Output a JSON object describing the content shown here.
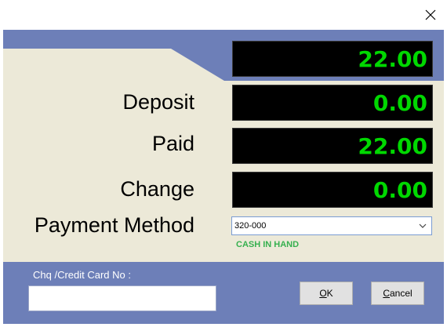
{
  "window": {
    "close_icon": "close-icon"
  },
  "displays": {
    "total": "22.00",
    "deposit": "0.00",
    "paid": "22.00",
    "change": "0.00"
  },
  "labels": {
    "deposit": "Deposit",
    "paid": "Paid",
    "change": "Change",
    "payment_method": "Payment Method"
  },
  "payment_method": {
    "selected": "320-000",
    "description": "CASH IN HAND"
  },
  "card": {
    "label": "Chq /Credit Card No :",
    "value": ""
  },
  "buttons": {
    "ok_mnemonic": "O",
    "ok_rest": "K",
    "cancel_mnemonic": "C",
    "cancel_rest": "ancel"
  },
  "colors": {
    "panel_blue": "#6d7fb8",
    "panel_beige": "#ece9d8",
    "display_bg": "#000000",
    "display_text": "#00d800",
    "method_desc": "#36b04f"
  }
}
